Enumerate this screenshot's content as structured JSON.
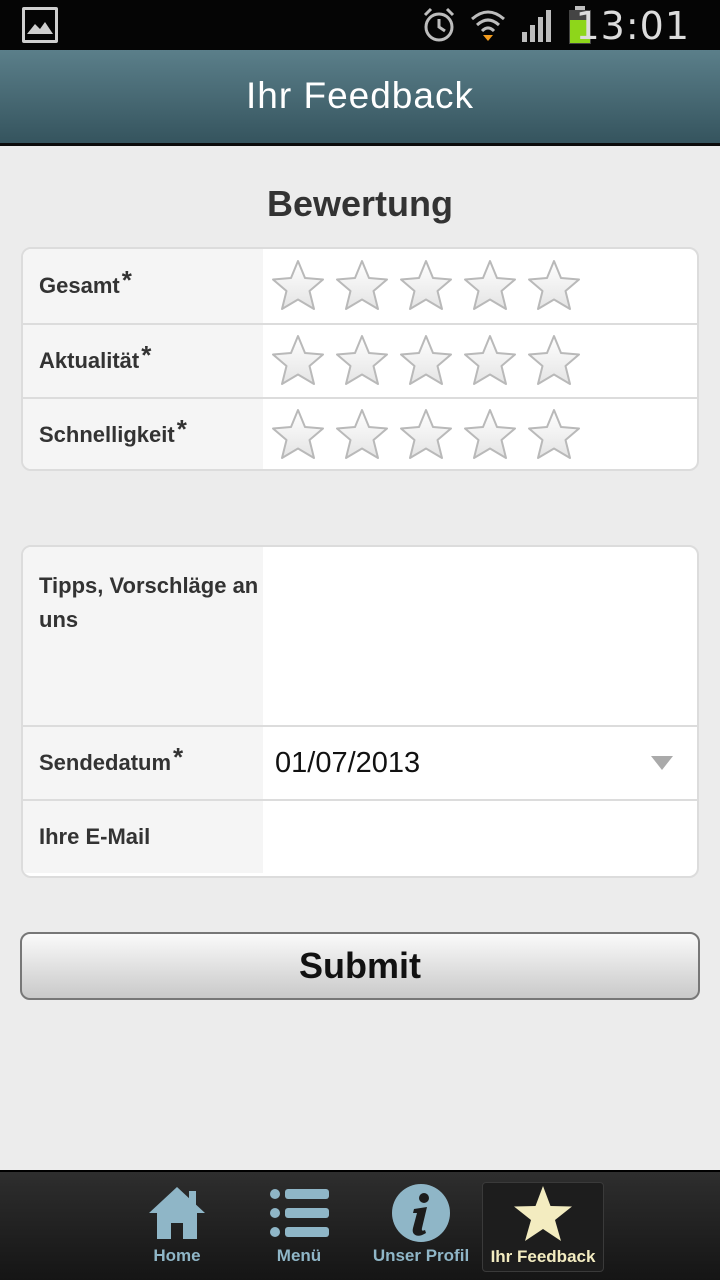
{
  "status_bar": {
    "time": "13:01"
  },
  "header": {
    "title": "Ihr Feedback"
  },
  "rating_section": {
    "title": "Bewertung",
    "required_mark": "*",
    "rows": [
      {
        "label": "Gesamt",
        "stars": 5
      },
      {
        "label": "Aktualität",
        "stars": 5
      },
      {
        "label": "Schnelligkeit",
        "stars": 5
      }
    ]
  },
  "form": {
    "tips_label": "Tipps, Vorschläge an uns",
    "tips_value": "",
    "date_label": "Sendedatum",
    "date_value": "01/07/2013",
    "email_label": "Ihre E-Mail",
    "email_value": "",
    "submit_label": "Submit"
  },
  "tabs": [
    {
      "label": "Home",
      "icon": "home-icon"
    },
    {
      "label": "Menü",
      "icon": "list-icon"
    },
    {
      "label": "Unser Profil",
      "icon": "info-icon"
    },
    {
      "label": "Ihr Feedback",
      "icon": "star-icon",
      "active": true
    }
  ],
  "colors": {
    "header": "#4a6c77",
    "tab_icon": "#8fb6c7",
    "tab_active": "#f3ecc0"
  }
}
